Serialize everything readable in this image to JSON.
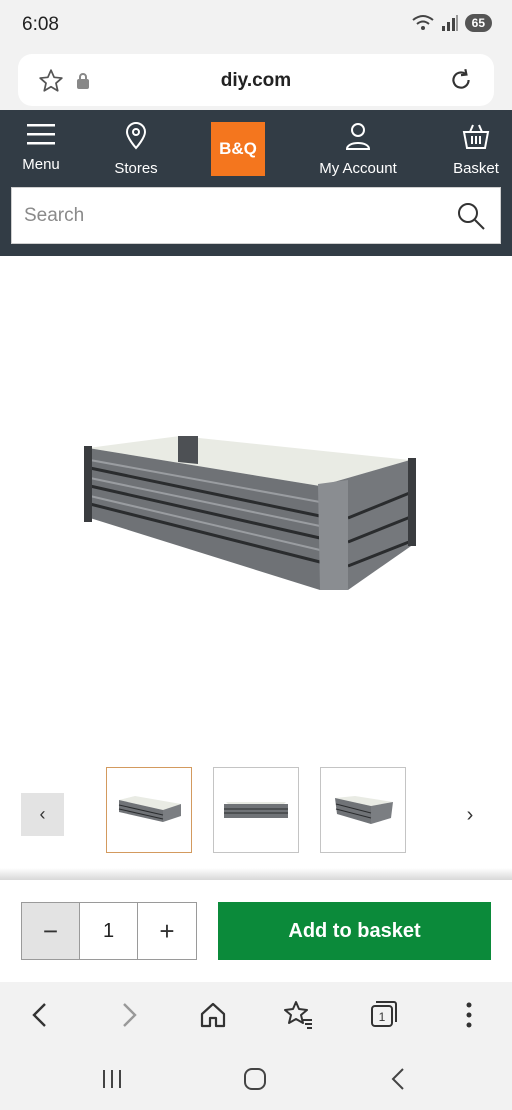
{
  "status_bar": {
    "time": "6:08",
    "battery": "65"
  },
  "browser": {
    "url": "diy.com"
  },
  "header": {
    "nav": [
      {
        "label": "Menu"
      },
      {
        "label": "Stores"
      },
      {
        "label": "My Account"
      },
      {
        "label": "Basket"
      }
    ],
    "logo_text": "B&Q",
    "search_placeholder": "Search"
  },
  "gallery": {
    "thumbnail_count": 3,
    "active_index": 0,
    "prev_label": "‹",
    "next_label": "›"
  },
  "purchase": {
    "quantity": "1",
    "minus_label": "−",
    "plus_label": "+",
    "add_label": "Add to basket"
  },
  "colors": {
    "header_bg": "#323c45",
    "brand_orange": "#f4761e",
    "cta_green": "#0b8a3a"
  }
}
